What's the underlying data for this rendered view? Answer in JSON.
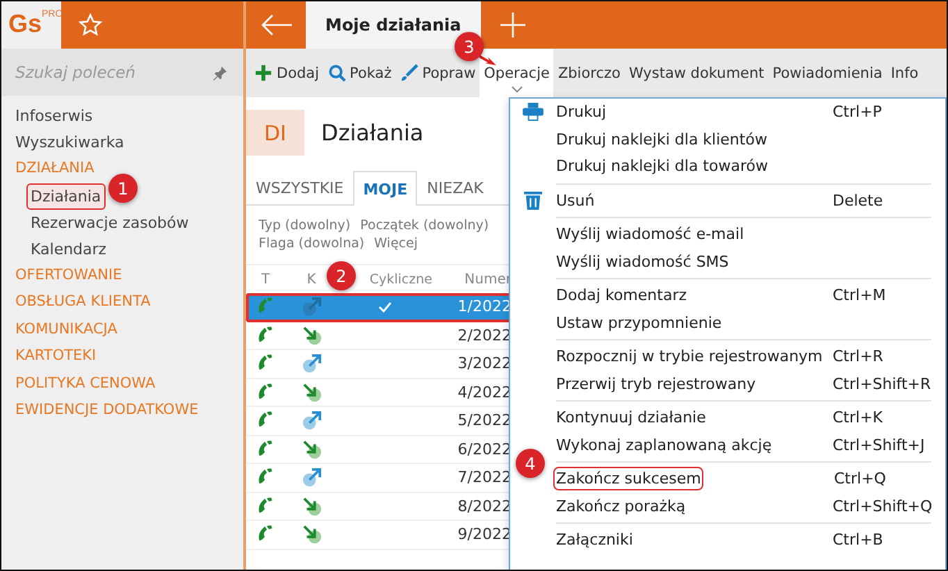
{
  "logo": {
    "text": "Gs",
    "sup": "PRO"
  },
  "open_tab": {
    "label": "Moje działania"
  },
  "sidebar": {
    "search": {
      "placeholder": "Szukaj poleceń"
    },
    "items": [
      {
        "label": "Infoserwis",
        "kind": "link"
      },
      {
        "label": "Wyszukiwarka",
        "kind": "link"
      },
      {
        "label": "DZIAŁANIA",
        "kind": "section",
        "children": [
          {
            "label": "Działania",
            "selected": true
          },
          {
            "label": "Rezerwacje zasobów",
            "selected": false
          },
          {
            "label": "Kalendarz",
            "selected": false
          }
        ]
      },
      {
        "label": "OFERTOWANIE",
        "kind": "section"
      },
      {
        "label": "OBSŁUGA KLIENTA",
        "kind": "section"
      },
      {
        "label": "KOMUNIKACJA",
        "kind": "section"
      },
      {
        "label": "KARTOTEKI",
        "kind": "section"
      },
      {
        "label": "POLITYKA CENOWA",
        "kind": "section"
      },
      {
        "label": "EWIDENCJE DODATKOWE",
        "kind": "section"
      }
    ]
  },
  "toolbar": [
    {
      "label": "Dodaj",
      "kind": "add",
      "selected": false
    },
    {
      "label": "Pokaż",
      "kind": "search",
      "selected": false
    },
    {
      "label": "Popraw",
      "kind": "edit",
      "selected": false
    },
    {
      "label": "Operacje",
      "kind": "dropdown",
      "selected": true
    },
    {
      "label": "Zbiorczo",
      "kind": "text",
      "selected": false
    },
    {
      "label": "Wystaw dokument",
      "kind": "text",
      "selected": false
    },
    {
      "label": "Powiadomienia",
      "kind": "text",
      "selected": false
    },
    {
      "label": "Info",
      "kind": "text",
      "selected": false
    }
  ],
  "module": {
    "badge": "DI",
    "title": "Działania"
  },
  "tabs": [
    {
      "label": "WSZYSTKIE",
      "selected": false
    },
    {
      "label": "MOJE",
      "selected": true
    },
    {
      "label": "NIEZAK",
      "selected": false
    }
  ],
  "filters": [
    [
      "Typ (dowolny)",
      "Początek (dowolny)"
    ],
    [
      "Flaga (dowolna)",
      "Więcej"
    ]
  ],
  "table": {
    "columns": [
      "T",
      "K",
      "Cykliczne",
      "Numer"
    ],
    "rows": [
      {
        "kind": "outgoing",
        "cyclic": true,
        "number": "1/2022",
        "selected": true
      },
      {
        "kind": "incoming",
        "cyclic": false,
        "number": "2/2022",
        "selected": false
      },
      {
        "kind": "outgoing",
        "cyclic": false,
        "number": "3/2022",
        "selected": false
      },
      {
        "kind": "incoming",
        "cyclic": false,
        "number": "4/2022",
        "selected": false
      },
      {
        "kind": "outgoing",
        "cyclic": false,
        "number": "5/2022",
        "selected": false
      },
      {
        "kind": "incoming",
        "cyclic": false,
        "number": "6/2022",
        "selected": false
      },
      {
        "kind": "outgoing",
        "cyclic": false,
        "number": "7/2022",
        "selected": false
      },
      {
        "kind": "incoming",
        "cyclic": false,
        "number": "8/2022",
        "selected": false
      },
      {
        "kind": "incoming",
        "cyclic": false,
        "number": "9/2022",
        "selected": false
      }
    ]
  },
  "menu": {
    "groups": [
      [
        {
          "label": "Drukuj",
          "shortcut": "Ctrl+P",
          "kind": "printer",
          "highlighted": false
        },
        {
          "label": "Drukuj naklejki dla klientów",
          "kind": "plain",
          "highlighted": false
        },
        {
          "label": "Drukuj naklejki dla towarów",
          "kind": "plain",
          "highlighted": false
        }
      ],
      [
        {
          "label": "Usuń",
          "shortcut": "Delete",
          "kind": "trash",
          "highlighted": false
        }
      ],
      [
        {
          "label": "Wyślij wiadomość e-mail",
          "kind": "plain",
          "highlighted": false
        },
        {
          "label": "Wyślij wiadomość SMS",
          "kind": "plain",
          "highlighted": false
        }
      ],
      [
        {
          "label": "Dodaj komentarz",
          "shortcut": "Ctrl+M",
          "kind": "plain",
          "highlighted": false
        },
        {
          "label": "Ustaw przypomnienie",
          "kind": "plain",
          "highlighted": false
        }
      ],
      [
        {
          "label": "Rozpocznij w trybie rejestrowanym",
          "shortcut": "Ctrl+R",
          "kind": "plain",
          "highlighted": false
        },
        {
          "label": "Przerwij tryb rejestrowany",
          "shortcut": "Ctrl+Shift+R",
          "kind": "plain",
          "highlighted": false
        }
      ],
      [
        {
          "label": "Kontynuuj działanie",
          "shortcut": "Ctrl+K",
          "kind": "plain",
          "highlighted": false
        },
        {
          "label": "Wykonaj zaplanowaną akcję",
          "shortcut": "Ctrl+Shift+J",
          "kind": "plain",
          "highlighted": false
        }
      ],
      [
        {
          "label": "Zakończ sukcesem",
          "shortcut": "Ctrl+Q",
          "kind": "plain",
          "highlighted": true
        },
        {
          "label": "Zakończ porażką",
          "shortcut": "Ctrl+Shift+Q",
          "kind": "plain",
          "highlighted": false
        }
      ],
      [
        {
          "label": "Załączniki",
          "shortcut": "Ctrl+B",
          "kind": "plain",
          "highlighted": false
        }
      ]
    ]
  },
  "annotations": [
    "1",
    "2",
    "3",
    "4"
  ]
}
